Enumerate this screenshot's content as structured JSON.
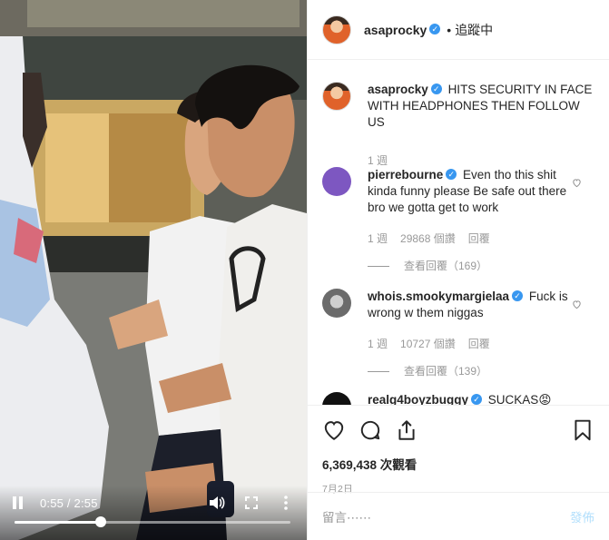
{
  "header": {
    "username": "asaprocky",
    "follow_status": "追蹤中"
  },
  "caption": {
    "username": "asaprocky",
    "text": "HITS SECURITY IN FACE WITH HEADPHONES THEN FOLLOW US",
    "age": "1 週"
  },
  "comments": [
    {
      "username": "pierrebourne",
      "text": "Even tho this shit kinda funny please Be safe out there bro we gotta get to work",
      "age": "1 週",
      "likes": "29868 個讚",
      "reply_label": "回覆",
      "view_replies": "查看回覆（169）"
    },
    {
      "username": "whois.smookymargielaa",
      "text": "Fuck is wrong w them niggas",
      "age": "1 週",
      "likes": "10727 個讚",
      "reply_label": "回覆",
      "view_replies": "查看回覆（139）"
    },
    {
      "username": "realg4boyzbuggy",
      "text": "SUCKAS😡"
    }
  ],
  "stats": {
    "views": "6,369,438 次觀看",
    "date": "7月2日"
  },
  "add_comment": {
    "placeholder": "留言⋯⋯",
    "post_label": "發佈"
  },
  "video": {
    "time": "0:55 / 2:55",
    "progress": 0.314
  },
  "icons": {
    "verified": "verified-badge-icon",
    "like": "heart-icon",
    "comment": "comment-icon",
    "share": "share-icon",
    "save": "bookmark-icon"
  },
  "colors": {
    "verified": "#3897f0",
    "post_button": "#b2dffc",
    "muted_text": "#999999"
  }
}
